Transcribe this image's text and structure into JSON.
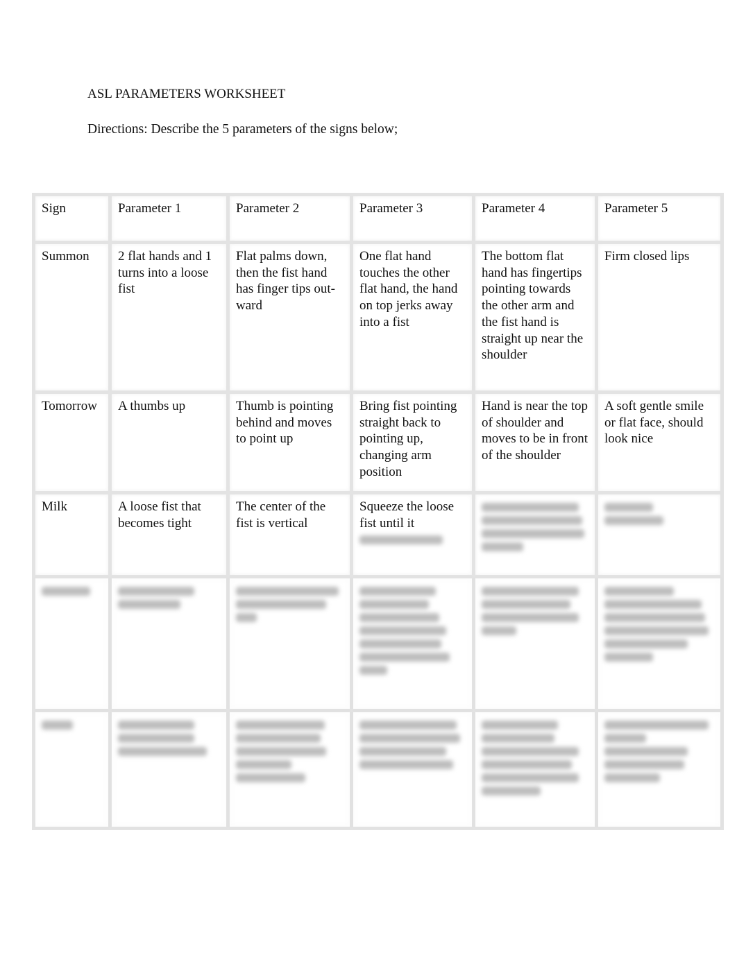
{
  "document": {
    "title": "ASL PARAMETERS WORKSHEET",
    "directions": "Directions: Describe the 5 parameters of the signs below;"
  },
  "table": {
    "headers": [
      "Sign",
      "Parameter 1",
      "Parameter 2",
      "Parameter 3",
      "Parameter 4",
      "Parameter 5"
    ],
    "rows": [
      {
        "sign": "Summon",
        "cells": [
          "2 flat hands and 1 turns into a loose fist",
          "Flat palms down, then the fist hand has finger tips out-ward",
          "One flat hand touches the other flat hand, the hand on top jerks away into a fist",
          "The bottom flat hand has fingertips pointing towards the other arm and the fist hand is straight up near the shoulder",
          "Firm closed lips"
        ]
      },
      {
        "sign": "Tomorrow",
        "cells": [
          "A thumbs up",
          "Thumb is pointing behind and moves to point up",
          "Bring fist pointing straight back to pointing up, changing arm position",
          "Hand is near the top of shoulder and moves to be in front of the shoulder",
          "A soft gentle smile or flat face, should look nice"
        ]
      },
      {
        "sign": "Milk",
        "cells": [
          "A loose fist that becomes tight",
          "The center of the fist is vertical",
          "Squeeze the loose fist until it",
          "",
          ""
        ],
        "blurred_cells": [
          false,
          false,
          false,
          true,
          true
        ]
      }
    ],
    "blurred_rows": 2
  }
}
